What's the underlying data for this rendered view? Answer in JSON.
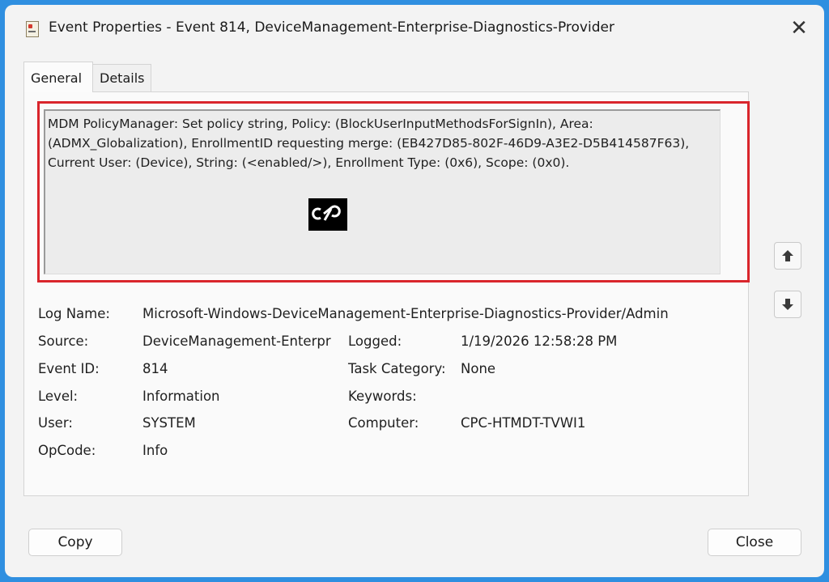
{
  "window": {
    "title": "Event Properties - Event 814, DeviceManagement-Enterprise-Diagnostics-Provider",
    "close_glyph": "✕"
  },
  "tabs": [
    {
      "label": "General",
      "selected": true
    },
    {
      "label": "Details",
      "selected": false
    }
  ],
  "description": "MDM PolicyManager: Set policy string, Policy: (BlockUserInputMethodsForSignIn), Area: (ADMX_Globalization), EnrollmentID requesting merge: (EB427D85-802F-46D9-A3E2-D5B414587F63), Current User: (Device), String: (<enabled/>), Enrollment Type: (0x6), Scope: (0x0).",
  "watermark_text": "HTMD Community",
  "fields": {
    "log_name": {
      "label": "Log Name:",
      "value": "Microsoft-Windows-DeviceManagement-Enterprise-Diagnostics-Provider/Admin"
    },
    "source": {
      "label": "Source:",
      "value": "DeviceManagement-Enterpr"
    },
    "logged": {
      "label": "Logged:",
      "value": "1/19/2026 12:58:28 PM"
    },
    "event_id": {
      "label": "Event ID:",
      "value": "814"
    },
    "task_category": {
      "label": "Task Category:",
      "value": "None"
    },
    "level": {
      "label": "Level:",
      "value": "Information"
    },
    "keywords": {
      "label": "Keywords:",
      "value": ""
    },
    "user": {
      "label": "User:",
      "value": "SYSTEM"
    },
    "computer": {
      "label": "Computer:",
      "value": "CPC-HTMDT-TVWI1"
    },
    "opcode": {
      "label": "OpCode:",
      "value": "Info"
    }
  },
  "buttons": {
    "copy": "Copy",
    "close": "Close",
    "up_icon": "arrow-up-icon",
    "down_icon": "arrow-down-icon"
  },
  "colors": {
    "highlight": "#d9252c",
    "background": "#2f8fe0"
  }
}
